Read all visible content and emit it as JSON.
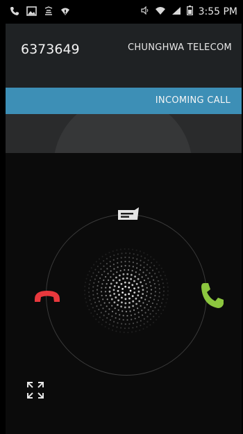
{
  "status_bar": {
    "time": "3:55 PM",
    "left_icons": [
      "phone-icon",
      "image-icon",
      "notification-icon",
      "wifi-alert-icon"
    ],
    "right_icons": [
      "vibrate-icon",
      "wifi-icon",
      "signal-icon",
      "battery-icon"
    ]
  },
  "caller": {
    "number": "6373649",
    "carrier": "CHUNGHWA TELECOM"
  },
  "call_state": {
    "label": "INCOMING CALL"
  },
  "actions": {
    "decline_icon": "phone-hangup-icon",
    "answer_icon": "phone-answer-icon",
    "message_icon": "message-icon",
    "expand_icon": "expand-icon"
  },
  "colors": {
    "band": "#3d8fb6",
    "decline": "#e8383d",
    "answer": "#8cc63f"
  }
}
